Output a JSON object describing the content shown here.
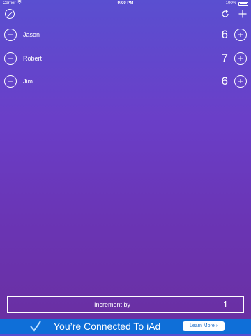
{
  "status_bar": {
    "carrier": "Carrier",
    "wifi_icon": "wifi-icon",
    "time": "9:00 PM",
    "battery_percent": "100%",
    "battery_icon": "battery-icon"
  },
  "toolbar": {
    "settings_icon": "pencil-circle-icon",
    "reset_icon": "refresh-icon",
    "add_icon": "plus-icon"
  },
  "players": [
    {
      "name": "Jason",
      "score": "6"
    },
    {
      "name": "Robert",
      "score": "7"
    },
    {
      "name": "Jim",
      "score": "6"
    }
  ],
  "increment": {
    "label": "Increment by",
    "value": "1"
  },
  "ad": {
    "text": "You’re Connected To iAd",
    "button_label": "Learn More ›",
    "icon": "checkmark-icon"
  },
  "colors": {
    "background_top": "#5a4fd0",
    "background_bottom": "#6a2fa0",
    "ad_blue": "#0f6fd8"
  }
}
